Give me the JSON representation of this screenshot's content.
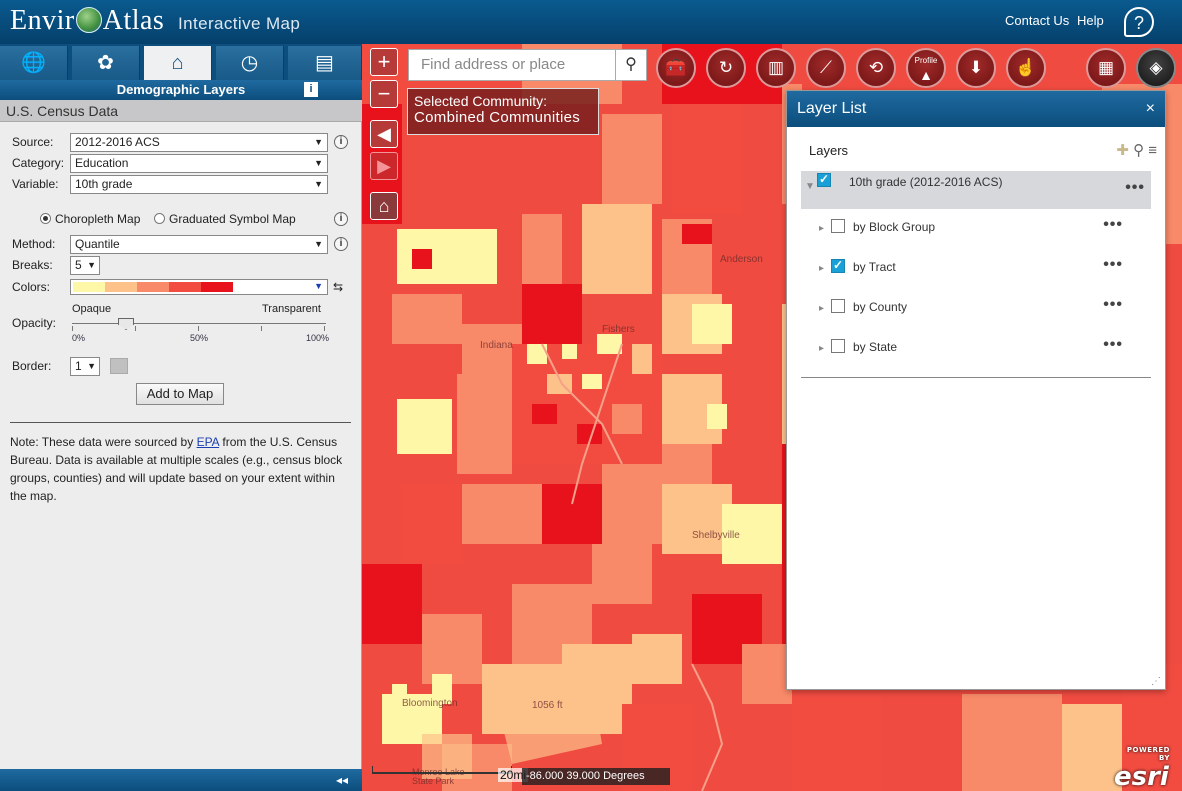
{
  "header": {
    "logo_left": "Envir",
    "logo_right": "Atlas",
    "subtitle": "Interactive Map",
    "contact": "Contact Us",
    "help": "Help"
  },
  "left_panel": {
    "tabs": [
      {
        "icon": "globe-plus-icon"
      },
      {
        "icon": "plant-hands-icon"
      },
      {
        "icon": "house-plus-icon"
      },
      {
        "icon": "history-clock-icon"
      },
      {
        "icon": "book-plus-icon"
      }
    ],
    "panel_title": "Demographic Layers",
    "section_header": "U.S. Census Data",
    "source_label": "Source:",
    "source_value": "2012-2016 ACS",
    "category_label": "Category:",
    "category_value": "Education",
    "variable_label": "Variable:",
    "variable_value": "10th grade",
    "radio_choropleth": "Choropleth Map",
    "radio_graduated": "Graduated Symbol Map",
    "method_label": "Method:",
    "method_value": "Quantile",
    "breaks_label": "Breaks:",
    "breaks_value": "5",
    "colors_label": "Colors:",
    "color_ramp": [
      "#fef7a8",
      "#fcc28a",
      "#f98a69",
      "#f24c41",
      "#e8121d"
    ],
    "opacity_label": "Opacity:",
    "opacity_left": "Opaque",
    "opacity_right": "Transparent",
    "opacity_value_percent": 24,
    "pct_0": "0%",
    "pct_50": "50%",
    "pct_100": "100%",
    "border_label": "Border:",
    "border_value": "1",
    "add_button": "Add to Map",
    "note_prefix": "Note: These data were sourced by ",
    "note_link": "EPA",
    "note_suffix": " from the U.S. Census Bureau. Data is available at multiple scales (e.g., census block groups, counties) and will update based on your extent within the map.",
    "collapse_icon": "◂◂"
  },
  "map": {
    "search_placeholder": "Find address or place",
    "community_line1": "Selected Community:",
    "community_line2": "Combined Communities",
    "labels": {
      "anderson": "Anderson",
      "fishers": "Fishers",
      "indiana": "Indiana",
      "shelbyville": "Shelbyville",
      "bloomington": "Bloomington",
      "lake_park": "Monroe Lake State Park",
      "elev": "1056 ft"
    },
    "scale_text": "20mi",
    "coords_text": "-86.000 39.000 Degrees",
    "esri_powered": "POWERED BY",
    "esri_text": "esri",
    "tool_icons": [
      "toolbox-icon",
      "eco-cycle-icon",
      "chart-icon",
      "draw-line-icon",
      "route-icon",
      "profile-icon",
      "download-icon",
      "select-icon",
      "basemap-grid-icon",
      "layers-icon"
    ],
    "tool_profile_label": "Profile"
  },
  "layer_list": {
    "title": "Layer List",
    "close": "×",
    "layers_label": "Layers",
    "items": [
      {
        "label": "10th grade (2012-2016 ACS)",
        "checked": true
      },
      {
        "label": "by Block Group",
        "checked": false
      },
      {
        "label": "by Tract",
        "checked": true
      },
      {
        "label": "by County",
        "checked": false
      },
      {
        "label": "by State",
        "checked": false
      }
    ],
    "more": "•••"
  }
}
